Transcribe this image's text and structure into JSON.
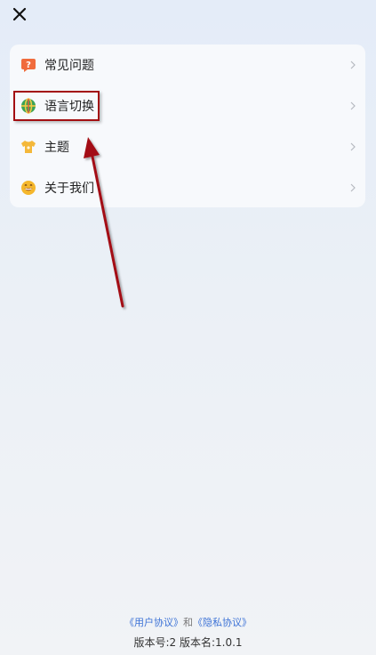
{
  "header": {
    "close_icon": "close-icon"
  },
  "menu": {
    "items": [
      {
        "label": "常见问题",
        "icon": "faq-icon",
        "color": "#f06b3c"
      },
      {
        "label": "语言切换",
        "icon": "globe-icon",
        "color": "#3aa356"
      },
      {
        "label": "主题",
        "icon": "shirt-icon",
        "color": "#f4b83a"
      },
      {
        "label": "关于我们",
        "icon": "smiley-icon",
        "color": "#f5b72c"
      }
    ]
  },
  "footer": {
    "user_agreement": "《用户协议》",
    "conjunction": "和",
    "privacy_agreement": "《隐私协议》",
    "version": "版本号:2 版本名:1.0.1"
  },
  "colors": {
    "annotation": "#a30f12",
    "link": "#3d73d6"
  }
}
